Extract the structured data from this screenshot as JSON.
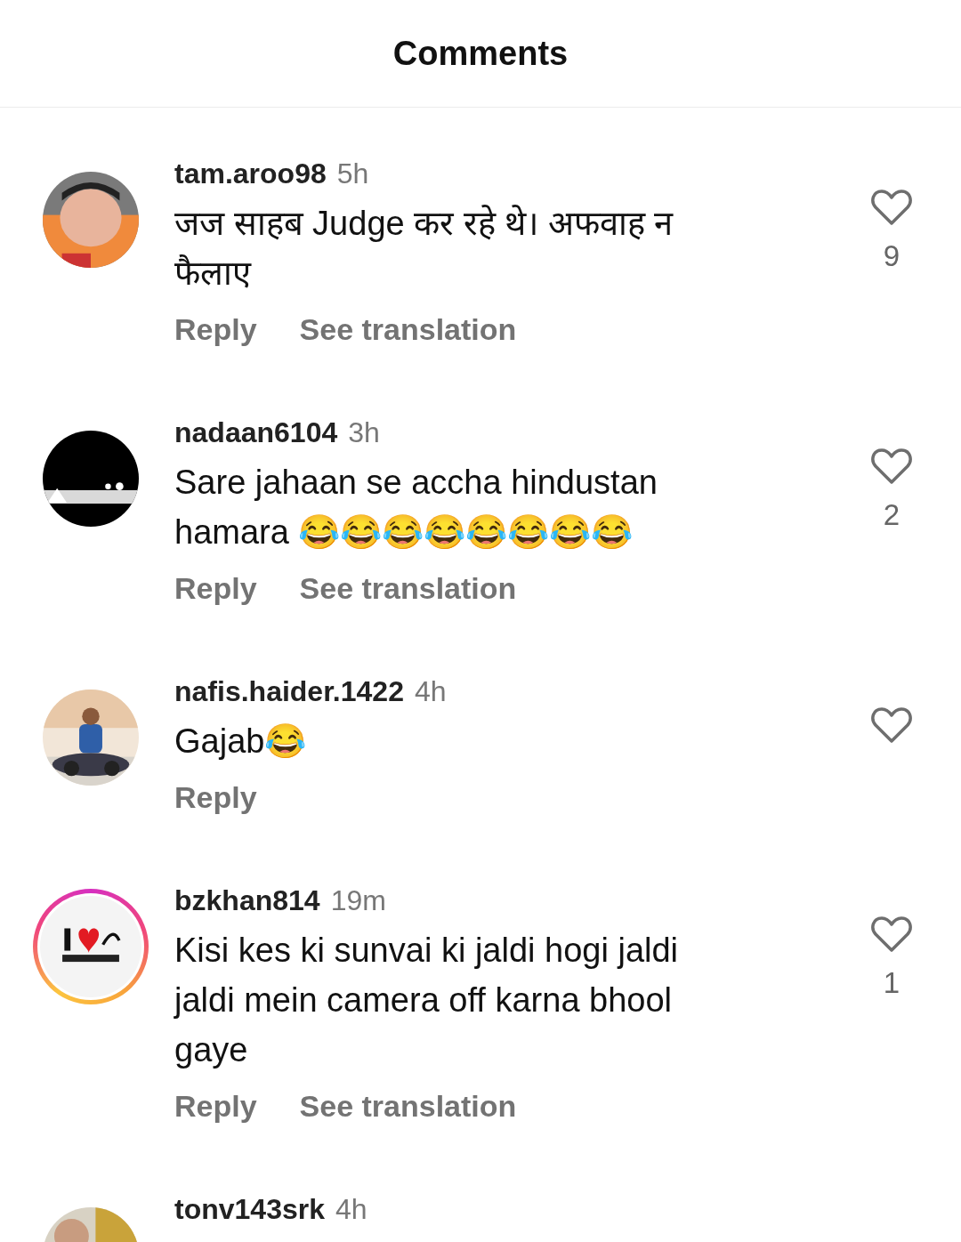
{
  "header": {
    "title": "Comments"
  },
  "comments": [
    {
      "username": "tam.aroo98",
      "time": "5h",
      "text": "जज साहब Judge कर रहे थे। अफवाह न फैलाए",
      "avatar": {
        "kind": "picture"
      },
      "story_ring": false,
      "actions": [
        "Reply",
        "See translation"
      ],
      "liked": false,
      "likes": "9"
    },
    {
      "username": "nadaan6104",
      "time": "3h",
      "text": "Sare jahaan se accha hindustan hamara 😂😂😂😂😂😂😂😂",
      "avatar": {
        "kind": "picture"
      },
      "story_ring": false,
      "actions": [
        "Reply",
        "See translation"
      ],
      "liked": false,
      "likes": "2"
    },
    {
      "username": "nafis.haider.1422",
      "time": "4h",
      "text": "Gajab😂",
      "avatar": {
        "kind": "picture"
      },
      "story_ring": false,
      "actions": [
        "Reply"
      ],
      "liked": false
    },
    {
      "username": "bzkhan814",
      "time": "19m",
      "text": "Kisi kes ki sunvai ki jaldi hogi jaldi jaldi mein camera off karna bhool gaye",
      "avatar": {
        "kind": "picture"
      },
      "story_ring": true,
      "actions": [
        "Reply",
        "See translation"
      ],
      "liked": false,
      "likes": "1"
    },
    {
      "username": "tonv143srk",
      "time": "4h",
      "avatar": {
        "kind": "picture"
      },
      "story_ring": false
    }
  ]
}
